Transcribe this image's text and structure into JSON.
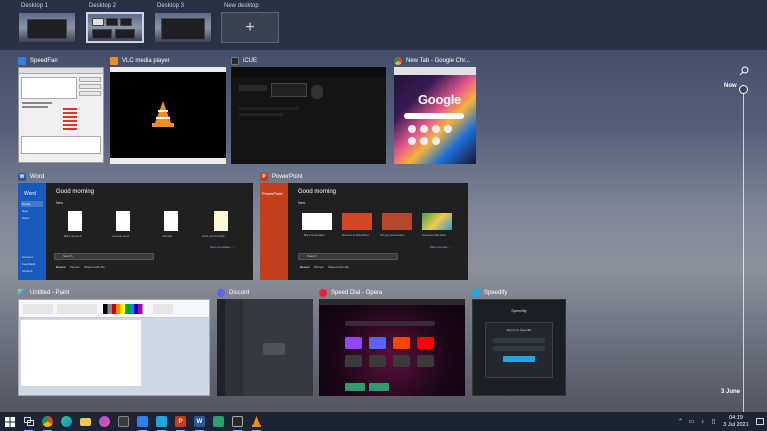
{
  "desktops": [
    {
      "label": "Desktop 1",
      "active": false
    },
    {
      "label": "Desktop 2",
      "active": true
    },
    {
      "label": "Desktop 3",
      "active": false
    },
    {
      "label": "New desktop",
      "active": false
    }
  ],
  "new_desktop_symbol": "+",
  "timeline": {
    "top_label": "Now",
    "bottom_label": "3 June",
    "search_icon": "search-icon"
  },
  "windows": {
    "speedfan": {
      "title": "SpeedFan"
    },
    "vlc": {
      "title": "VLC media player"
    },
    "icue": {
      "title": "iCUE"
    },
    "chrome": {
      "title": "New Tab - Google Chr...",
      "logo": "Google"
    },
    "word": {
      "title": "Word",
      "app_label": "Word",
      "greeting": "Good morning",
      "new_label": "New",
      "templates": [
        "Blank document",
        "Generate ideas",
        "Calendar",
        "Insert your first table"
      ],
      "more": "More templates →",
      "tabs": [
        "Recent",
        "Pinned",
        "Shared with Me"
      ],
      "search": "Search",
      "nav": [
        "Home",
        "New",
        "Open",
        "Account",
        "Feedback",
        "Options"
      ]
    },
    "powerpoint": {
      "title": "PowerPoint",
      "app_label": "PowerPoint",
      "greeting": "Good morning",
      "new_label": "New",
      "templates": [
        "Blank Presentation",
        "Welcome to PowerPoint",
        "Tell your presentation...",
        "Geometric slide block"
      ],
      "more": "More themes →",
      "tabs": [
        "Recent",
        "Pinned",
        "Shared with Me"
      ],
      "search": "Search"
    },
    "paint": {
      "title": "Untitled - Paint"
    },
    "discord": {
      "title": "Discord"
    },
    "opera": {
      "title": "Speed Dial - Opera"
    },
    "speedify": {
      "title": "Speedify",
      "heading": "Speedify",
      "msg": "Sign in to Speedify"
    }
  },
  "taskbar": {
    "items": [
      {
        "name": "start-icon",
        "glyph": "",
        "color": "#00a4ef"
      },
      {
        "name": "task-view-icon",
        "glyph": "",
        "color": "#2b3347"
      },
      {
        "name": "chrome-icon",
        "glyph": "",
        "color": "#db4437"
      },
      {
        "name": "edge-icon",
        "glyph": "",
        "color": "#0c8bd6"
      },
      {
        "name": "file-explorer-icon",
        "glyph": "",
        "color": "#f2c94c"
      },
      {
        "name": "messenger-icon",
        "glyph": "",
        "color": "#a14cf0"
      },
      {
        "name": "terminal-icon",
        "glyph": "",
        "color": "#3a3a3a"
      },
      {
        "name": "speedfan-icon",
        "glyph": "",
        "color": "#2f80ed"
      },
      {
        "name": "fan-icon",
        "glyph": "",
        "color": "#4aa3df"
      },
      {
        "name": "powerpoint-icon",
        "glyph": "P",
        "color": "#c43e1c"
      },
      {
        "name": "word-icon",
        "glyph": "W",
        "color": "#2b579a"
      },
      {
        "name": "gpu-icon",
        "glyph": "",
        "color": "#2d9d6a"
      },
      {
        "name": "icue-icon",
        "glyph": "",
        "color": "#2a2a2a"
      },
      {
        "name": "vlc-icon",
        "glyph": "",
        "color": "#f28c1b"
      }
    ],
    "clock_time": "04:19",
    "clock_date": "3 Jul 2021"
  }
}
